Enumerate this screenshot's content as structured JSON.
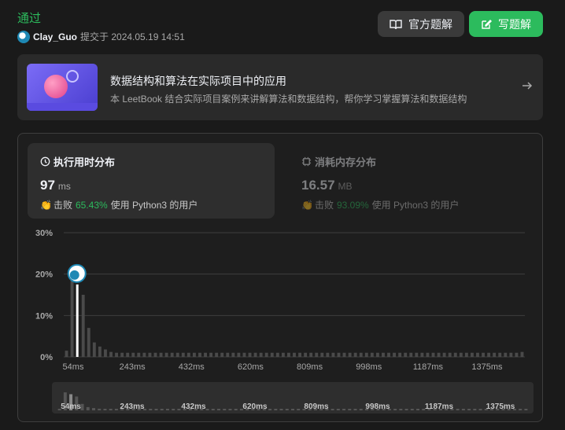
{
  "header": {
    "status": "通过",
    "username": "Clay_Guo",
    "submitted_at": "提交于 2024.05.19 14:51",
    "solution_button": "官方题解",
    "write_button": "写题解"
  },
  "book": {
    "title": "数据结构和算法在实际项目中的应用",
    "description": "本 LeetBook 结合实际项目案例来讲解算法和数据结构，帮你学习掌握算法和数据结构"
  },
  "runtime_tab": {
    "label": "执行用时分布",
    "value": "97",
    "unit": "ms",
    "beats_prefix": "击败",
    "beats_pct": "65.43%",
    "beats_suffix": "使用 Python3 的用户"
  },
  "memory_tab": {
    "label": "消耗内存分布",
    "value": "16.57",
    "unit": "MB",
    "beats_prefix": "击败",
    "beats_pct": "93.09%",
    "beats_suffix": "使用 Python3 的用户"
  },
  "colors": {
    "accent": "#2cbb5d",
    "highlight_bar": "#ffffff",
    "bar": "#4a4a4a"
  },
  "chart_data": {
    "type": "bar",
    "title": "",
    "xlabel": "",
    "ylabel": "",
    "ylim": [
      0,
      30
    ],
    "y_ticks": [
      "0%",
      "10%",
      "20%",
      "30%"
    ],
    "x_tick_labels": [
      "54ms",
      "243ms",
      "432ms",
      "620ms",
      "809ms",
      "998ms",
      "1187ms",
      "1375ms"
    ],
    "highlight_index": 2,
    "values": [
      1.5,
      19.5,
      17.5,
      15.0,
      7.0,
      3.5,
      2.5,
      1.8,
      1.2,
      1.0,
      1.0,
      1.0,
      1.0,
      1.0,
      1.0,
      1.0,
      1.0,
      1.0,
      1.0,
      1.0,
      1.0,
      1.0,
      1.0,
      1.0,
      1.0,
      1.0,
      1.0,
      1.0,
      1.0,
      1.0,
      1.0,
      1.0,
      1.0,
      1.0,
      1.0,
      1.0,
      1.0,
      1.0,
      1.0,
      1.0,
      1.0,
      1.0,
      1.0,
      1.0,
      1.0,
      1.0,
      1.0,
      1.0,
      1.0,
      1.0,
      1.0,
      1.0,
      1.0,
      1.0,
      1.0,
      1.0,
      1.0,
      1.0,
      1.0,
      1.0,
      1.0,
      1.0,
      1.0,
      1.0,
      1.0,
      1.0,
      1.0,
      1.0,
      1.0,
      1.0,
      1.0,
      1.0,
      1.0,
      1.0,
      1.0,
      1.0,
      1.0,
      1.0,
      1.0,
      1.0,
      1.0,
      1.0,
      1.2
    ]
  }
}
